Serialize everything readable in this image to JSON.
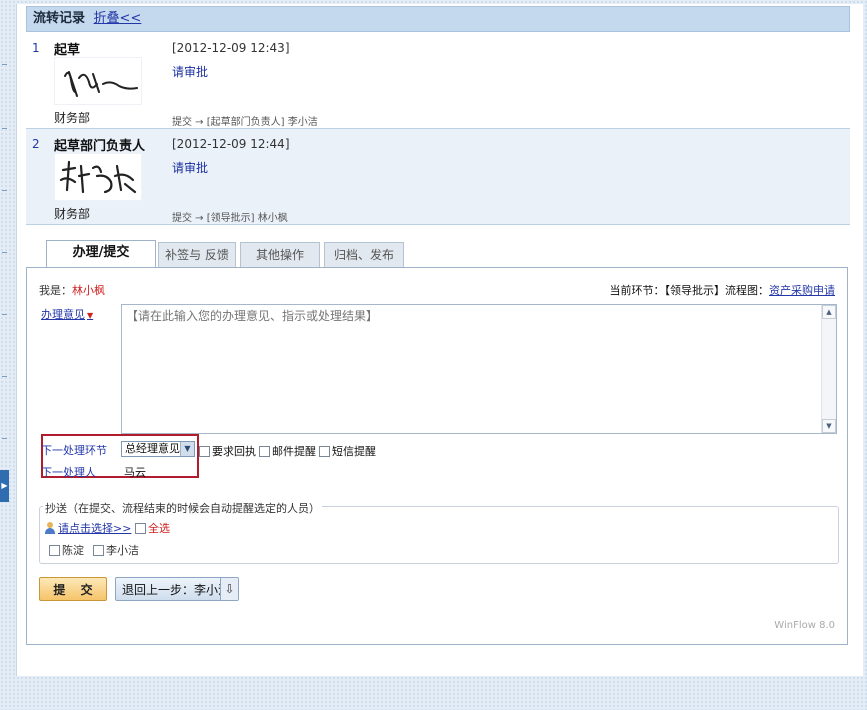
{
  "header": {
    "title": "流转记录",
    "collapse_link": "折叠<<"
  },
  "records": [
    {
      "num": "1",
      "role": "起草",
      "dept": "财务部",
      "time": "[2012-12-09 12:43]",
      "opinion": "请审批",
      "trace": "提交 → [起草部门负责人] 李小洁"
    },
    {
      "num": "2",
      "role": "起草部门负责人",
      "dept": "财务部",
      "time": "[2012-12-09 12:44]",
      "opinion": "请审批",
      "trace": "提交 → [领导批示] 林小枫"
    }
  ],
  "tabs": [
    {
      "label": "办理/提交",
      "active": true
    },
    {
      "label": "补签与 反馈",
      "active": false
    },
    {
      "label": "其他操作",
      "active": false
    },
    {
      "label": "归档、发布",
      "active": false
    }
  ],
  "panel": {
    "me_label": "我是：",
    "me_name": "林小枫",
    "current_step": "当前环节：【领导批示】流程图：",
    "flowchart_link": "资产采购申请",
    "opinion_label": "办理意见",
    "opinion_required_mark": "▼",
    "opinion_placeholder": "【请在此输入您的办理意见、指示或处理结果】",
    "next_step_label": "下一处理环节",
    "next_step_value": "总经理意见",
    "next_person_label": "下一处理人",
    "next_person_value": "马云",
    "options": [
      "要求回执",
      "邮件提醒",
      "短信提醒"
    ]
  },
  "cc": {
    "legend": "抄送（在提交、流程结束的时候会自动提醒选定的人员）",
    "pick_link": "请点击选择>>",
    "select_all": "全选",
    "people": [
      "陈淀",
      "李小洁"
    ]
  },
  "buttons": {
    "submit": "提 交",
    "back": "退回上一步：李小洁",
    "back_icon": "⇩"
  },
  "footer": {
    "version": "WinFlow 8.0"
  },
  "colors": {
    "accent_link": "#2337a8",
    "highlight_box": "#b01c2e",
    "header_bg": "#c5d9ee"
  }
}
